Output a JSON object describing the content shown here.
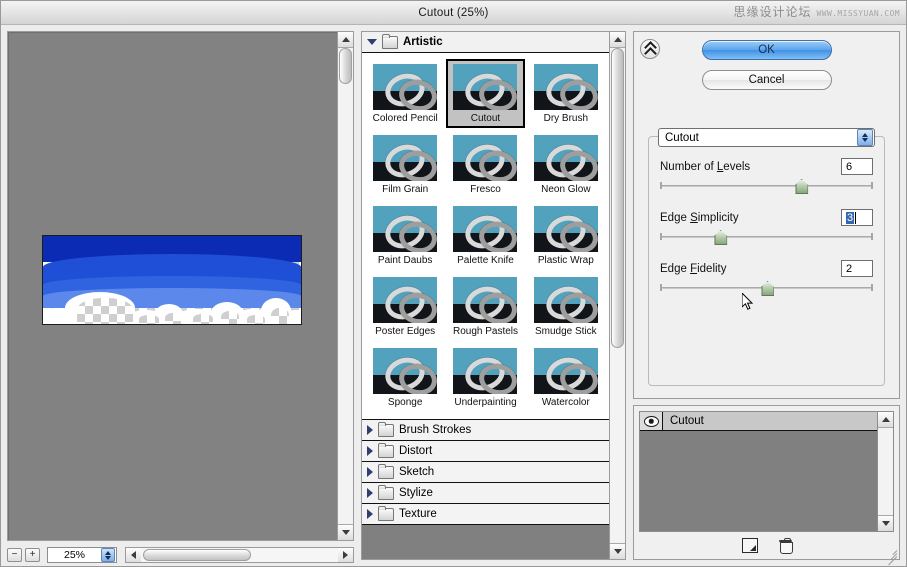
{
  "window": {
    "title": "Cutout (25%)",
    "watermark_cn": "思缘设计论坛",
    "watermark_en": "WWW.MISSYUAN.COM"
  },
  "preview": {
    "zoom_value": "25%",
    "zoom_out_label": "−",
    "zoom_in_label": "+",
    "scroll_up_icon": "triangle-up-icon",
    "scroll_down_icon": "triangle-down-icon",
    "scroll_left_icon": "triangle-left-icon",
    "scroll_right_icon": "triangle-right-icon"
  },
  "filter_browser": {
    "expanded_category": {
      "label": "Artistic",
      "expanded": true,
      "disclosure_icon": "triangle-down-icon",
      "folder_icon": "folder-open-icon"
    },
    "thumbnails": [
      {
        "label": "Colored Pencil",
        "selected": false
      },
      {
        "label": "Cutout",
        "selected": true
      },
      {
        "label": "Dry Brush",
        "selected": false
      },
      {
        "label": "Film Grain",
        "selected": false
      },
      {
        "label": "Fresco",
        "selected": false
      },
      {
        "label": "Neon Glow",
        "selected": false
      },
      {
        "label": "Paint Daubs",
        "selected": false
      },
      {
        "label": "Palette Knife",
        "selected": false
      },
      {
        "label": "Plastic Wrap",
        "selected": false
      },
      {
        "label": "Poster Edges",
        "selected": false
      },
      {
        "label": "Rough Pastels",
        "selected": false
      },
      {
        "label": "Smudge Stick",
        "selected": false
      },
      {
        "label": "Sponge",
        "selected": false
      },
      {
        "label": "Underpainting",
        "selected": false
      },
      {
        "label": "Watercolor",
        "selected": false
      }
    ],
    "collapsed_categories": [
      {
        "label": "Brush Strokes",
        "disclosure_icon": "triangle-right-icon",
        "folder_icon": "folder-closed-icon"
      },
      {
        "label": "Distort",
        "disclosure_icon": "triangle-right-icon",
        "folder_icon": "folder-closed-icon"
      },
      {
        "label": "Sketch",
        "disclosure_icon": "triangle-right-icon",
        "folder_icon": "folder-closed-icon"
      },
      {
        "label": "Stylize",
        "disclosure_icon": "triangle-right-icon",
        "folder_icon": "folder-closed-icon"
      },
      {
        "label": "Texture",
        "disclosure_icon": "triangle-right-icon",
        "folder_icon": "folder-closed-icon"
      }
    ]
  },
  "options": {
    "collapse_icon": "double-chevron-up-icon",
    "ok_label": "OK",
    "cancel_label": "Cancel",
    "filter_select_value": "Cutout",
    "filter_select_icon": "spinner-up-down-icon",
    "sliders": [
      {
        "label_before": "Number of ",
        "label_mnemonic": "L",
        "label_after": "evels",
        "value": "6",
        "position_pct": 66,
        "focused": false
      },
      {
        "label_before": "Edge ",
        "label_mnemonic": "S",
        "label_after": "implicity",
        "value": "3",
        "position_pct": 28,
        "focused": true
      },
      {
        "label_before": "Edge ",
        "label_mnemonic": "F",
        "label_after": "idelity",
        "value": "2",
        "position_pct": 50,
        "focused": false
      }
    ]
  },
  "effects": {
    "layers": [
      {
        "name": "Cutout",
        "visible": true,
        "visibility_icon": "eye-icon"
      }
    ],
    "new_effect_layer_icon": "new-layer-icon",
    "delete_effect_layer_icon": "trash-icon",
    "resize_grip_icon": "resize-grip-icon"
  },
  "colors": {
    "selected_thumb_bg": "#c2c2c2",
    "ok_button_blue": "#5ba7ef",
    "canvas_gray": "#828282",
    "field_highlight": "#3268ad",
    "slider_knob_green": "#88a87c"
  }
}
